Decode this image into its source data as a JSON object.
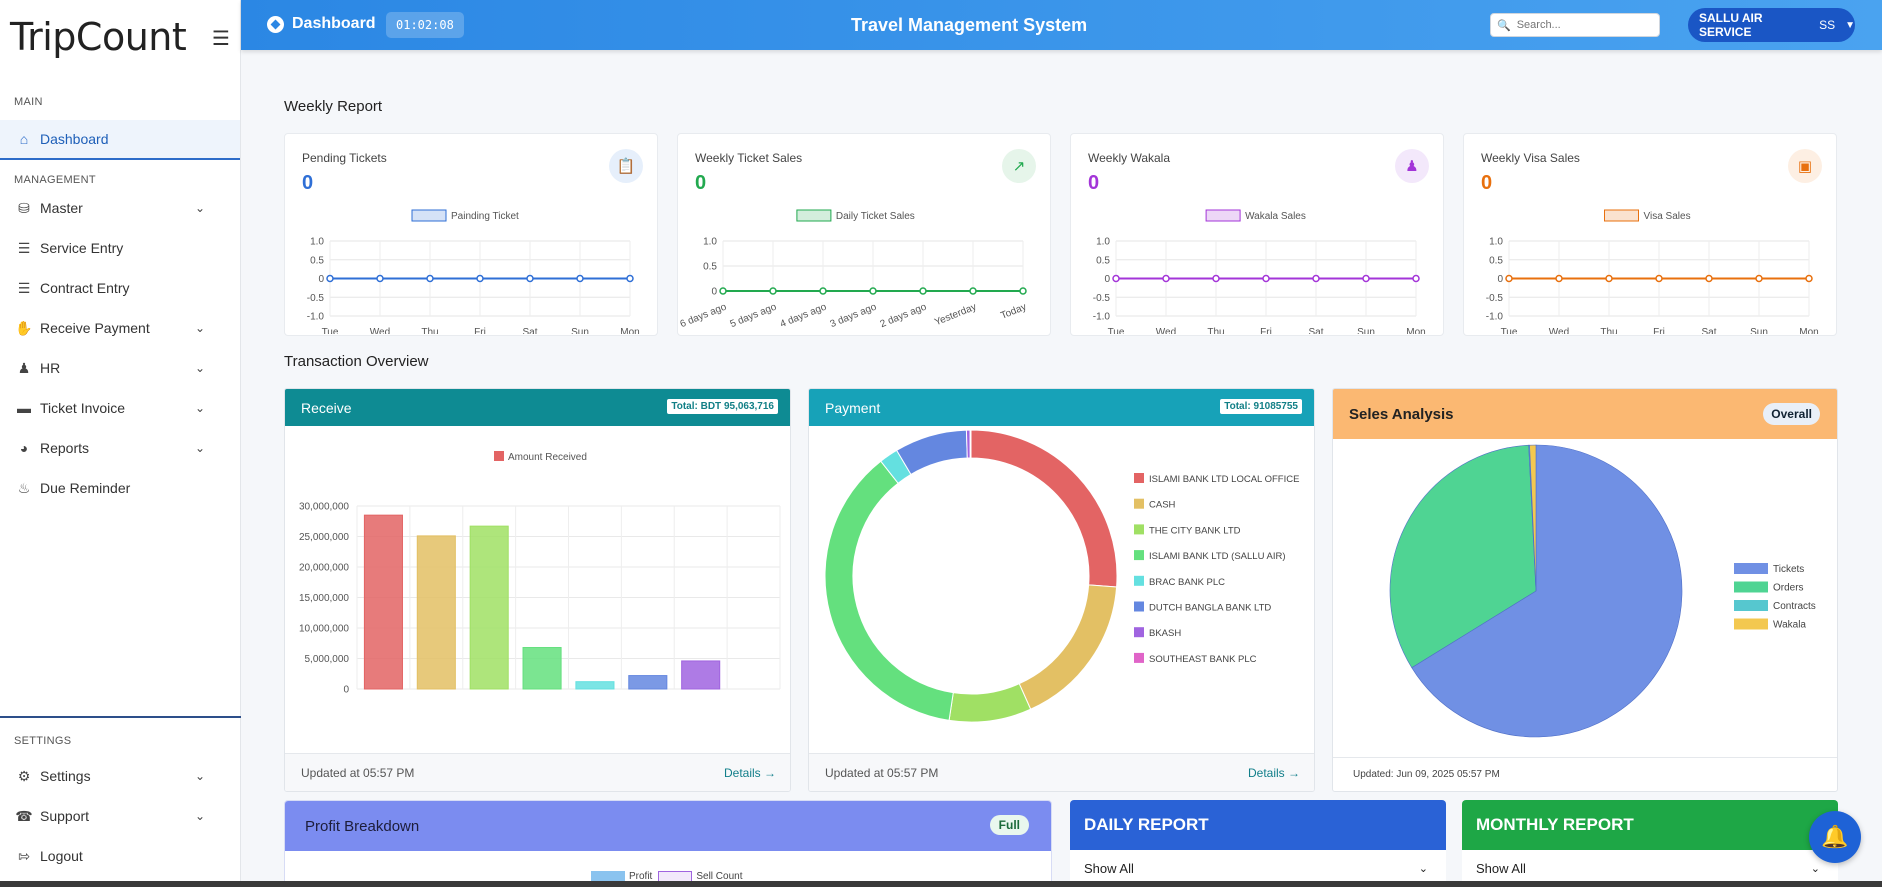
{
  "logo": "TripCount",
  "sidebar": {
    "main_label": "MAIN",
    "dashboard": "Dashboard",
    "management_label": "MANAGEMENT",
    "items": [
      "Master",
      "Service Entry",
      "Contract Entry",
      "Receive Payment",
      "HR",
      "Ticket Invoice",
      "Reports",
      "Due Reminder"
    ],
    "settings_label": "SETTINGS",
    "settings": "Settings",
    "support": "Support",
    "logout": "Logout"
  },
  "header": {
    "page": "Dashboard",
    "timer": "01:02:08",
    "title": "Travel Management System",
    "search_placeholder": "Search...",
    "user": "SALLU AIR SERVICE",
    "initials": "SS"
  },
  "weekly": {
    "heading": "Weekly Report",
    "cards": [
      {
        "title": "Pending Tickets",
        "value": "0",
        "color": "#2f6fd6",
        "legend": "Painding Ticket",
        "icon": "clipboard-icon"
      },
      {
        "title": "Weekly Ticket Sales",
        "value": "0",
        "color": "#22a94f",
        "legend": "Daily Ticket Sales",
        "icon": "trend-up-icon"
      },
      {
        "title": "Weekly Wakala",
        "value": "0",
        "color": "#a335d8",
        "legend": "Wakala Sales",
        "icon": "users-icon"
      },
      {
        "title": "Weekly Visa Sales",
        "value": "0",
        "color": "#e8700e",
        "legend": "Visa Sales",
        "icon": "card-icon"
      }
    ]
  },
  "chart_data": [
    {
      "type": "line",
      "title": "",
      "series": [
        {
          "name": "Painding Ticket",
          "values": [
            0,
            0,
            0,
            0,
            0,
            0,
            0
          ]
        }
      ],
      "categories": [
        "Tue",
        "Wed",
        "Thu",
        "Fri",
        "Sat",
        "Sun",
        "Mon"
      ],
      "ylim": [
        -1.0,
        1.0
      ],
      "yticks": [
        "1.0",
        "0.5",
        "0",
        "-0.5",
        "-1.0"
      ]
    },
    {
      "type": "line",
      "title": "",
      "series": [
        {
          "name": "Daily Ticket Sales",
          "values": [
            0,
            0,
            0,
            0,
            0,
            0,
            0
          ]
        }
      ],
      "categories": [
        "6 days ago",
        "5 days ago",
        "4 days ago",
        "3 days ago",
        "2 days ago",
        "Yesterday",
        "Today"
      ],
      "ylim": [
        0,
        1.0
      ],
      "yticks": [
        "1.0",
        "0.5",
        "0"
      ]
    },
    {
      "type": "line",
      "title": "",
      "series": [
        {
          "name": "Wakala Sales",
          "values": [
            0,
            0,
            0,
            0,
            0,
            0,
            0
          ]
        }
      ],
      "categories": [
        "Tue",
        "Wed",
        "Thu",
        "Fri",
        "Sat",
        "Sun",
        "Mon"
      ],
      "ylim": [
        -1.0,
        1.0
      ],
      "yticks": [
        "1.0",
        "0.5",
        "0",
        "-0.5",
        "-1.0"
      ]
    },
    {
      "type": "line",
      "title": "",
      "series": [
        {
          "name": "Visa Sales",
          "values": [
            0,
            0,
            0,
            0,
            0,
            0,
            0
          ]
        }
      ],
      "categories": [
        "Tue",
        "Wed",
        "Thu",
        "Fri",
        "Sat",
        "Sun",
        "Mon"
      ],
      "ylim": [
        -1.0,
        1.0
      ],
      "yticks": [
        "1.0",
        "0.5",
        "0",
        "-0.5",
        "-1.0"
      ]
    },
    {
      "type": "bar",
      "title": "",
      "series": [
        {
          "name": "Amount Received",
          "values": [
            28500000,
            25100000,
            26700000,
            6800000,
            1200000,
            2200000,
            4600000,
            0
          ]
        }
      ],
      "categories": [
        "ISLAMI BANK LTD LOCAL OFFICE",
        "CASH",
        "THE CITY BANK LTD",
        "ISLAMI BANK LTD (SALLU AIR)",
        "BRAC BANK PLC",
        "DUTCH BANGLA BANK LTD",
        "BKASH",
        "SOUTHEAST BANK PLC"
      ],
      "ylim": [
        0,
        30000000
      ],
      "yticks": [
        "30,000,000",
        "25,000,000",
        "20,000,000",
        "15,000,000",
        "10,000,000",
        "5,000,000",
        "0"
      ],
      "colors": [
        "#e36464",
        "#e3c064",
        "#a0e064",
        "#64e07e",
        "#64e0e0",
        "#6487e0",
        "#a064e0",
        "#e064c8"
      ]
    },
    {
      "type": "pie",
      "title": "",
      "labels": [
        "ISLAMI BANK LTD LOCAL OFFICE",
        "CASH",
        "THE CITY BANK LTD",
        "ISLAMI BANK LTD (SALLU AIR)",
        "BRAC BANK PLC",
        "DUTCH BANGLA BANK LTD",
        "BKASH",
        "SOUTHEAST BANK PLC"
      ],
      "values": [
        26.2,
        17.1,
        9.1,
        37.0,
        2.1,
        8.0,
        0.4,
        0.1
      ],
      "colors": [
        "#e36464",
        "#e3c064",
        "#a0e064",
        "#64e07e",
        "#64e0e0",
        "#6487e0",
        "#a064e0",
        "#e064c8"
      ]
    },
    {
      "type": "pie",
      "title": "",
      "labels": [
        "Tickets",
        "Orders",
        "Contracts",
        "Wakala"
      ],
      "values": [
        66.2,
        33.0,
        0.1,
        0.7
      ],
      "colors": [
        "#7090e4",
        "#4fd493",
        "#56c7cf",
        "#f3c850"
      ]
    },
    {
      "type": "line",
      "title": "",
      "series": [
        {
          "name": "Profit"
        },
        {
          "name": "Sell Count"
        }
      ]
    }
  ],
  "overview": {
    "heading": "Transaction Overview",
    "receive_title": "Receive",
    "receive_total": "Total: BDT 95,063,716",
    "payment_title": "Payment",
    "payment_total": "Total: 91085755",
    "sales_title": "Seles Analysis",
    "sales_badge": "Overall",
    "updated": "Updated at 05:57 PM",
    "details": "Details →",
    "sales_updated": "Updated: Jun 09, 2025 05:57 PM"
  },
  "bottom": {
    "profit_title": "Profit Breakdown",
    "profit_badge": "Full",
    "daily_title": "DAILY REPORT",
    "daily_select": "Show All",
    "monthly_title": "MONTHLY REPORT",
    "monthly_select": "Show All"
  }
}
